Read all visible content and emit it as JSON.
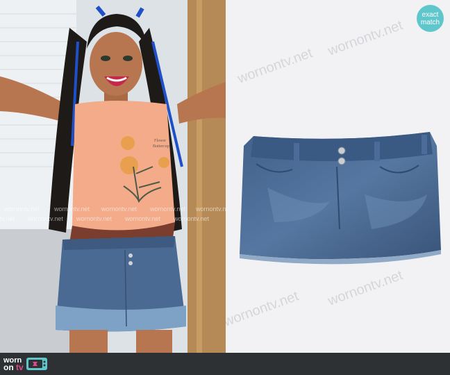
{
  "badge": {
    "line1": "exact",
    "line2": "match"
  },
  "brand": {
    "line1": "worn",
    "line2_prefix": "on ",
    "line2_accent": "tv"
  },
  "watermark": "wornontv.net",
  "shirt_print": {
    "line1": "Flower",
    "line2": "Buttercup"
  },
  "colors": {
    "badge": "#5fc7cc",
    "bar": "#2e3133",
    "accent": "#e5488c",
    "denim": "#4a6a93",
    "shirt": "#f3ab8a"
  },
  "icons": {
    "logo": "tv-icon"
  }
}
